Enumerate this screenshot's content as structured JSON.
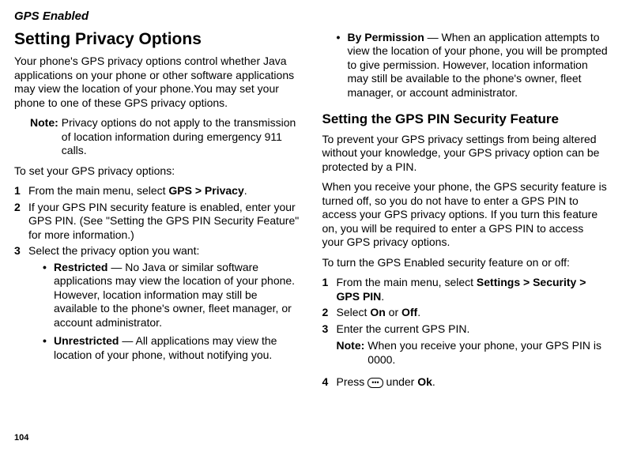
{
  "header": {
    "section_title": "GPS Enabled"
  },
  "left": {
    "h1": "Setting Privacy Options",
    "intro": "Your phone's GPS privacy options control whether Java applications on your phone or other software applications may view the location of your phone.You may set your phone to one of these GPS privacy options.",
    "note_label": "Note:",
    "note_text": "Privacy options do not apply to the transmission of location information during emergency 911 calls.",
    "to_set": "To set your GPS privacy options:",
    "step1_pre": "From the main menu, select ",
    "step1_bold": "GPS > Privacy",
    "step1_post": ".",
    "step2": "If your GPS PIN security feature is enabled, enter your GPS PIN. (See \"Setting the GPS PIN Security Feature\" for more information.)",
    "step3": "Select the privacy option you want:",
    "opt1_title": "Restricted",
    "opt1_body": " — No Java or similar software applications may view the location of your phone. However, location information may still be available to the phone's owner, fleet manager, or account administrator.",
    "opt2_title": "Unrestricted",
    "opt2_body": " — All applications may view the location of your phone, without notifying you."
  },
  "right": {
    "opt3_title": "By Permission",
    "opt3_body": " — When an application attempts to view the location of your phone, you will be prompted to give permission. However, location information may still be available to the phone's owner, fleet manager, or account administrator.",
    "h2": "Setting the GPS PIN Security Feature",
    "p1": "To prevent your GPS privacy settings from being altered without your knowledge, your GPS privacy option can be protected by a PIN.",
    "p2": "When you receive your phone, the GPS security feature is turned off, so you do not have to enter a GPS PIN to access your GPS privacy options. If you turn this feature on, you will be required to enter a GPS PIN to access your GPS privacy options.",
    "p3": "To turn the GPS Enabled security feature on or off:",
    "r_step1_pre": "From the main menu, select ",
    "r_step1_bold": "Settings > Security > GPS PIN",
    "r_step1_post": ".",
    "r_step2_pre": "Select ",
    "r_step2_on": "On",
    "r_step2_or": " or ",
    "r_step2_off": "Off",
    "r_step2_post": ".",
    "r_step3": "Enter the current GPS PIN.",
    "r_note_label": "Note:",
    "r_note_text": "When you receive your phone, your GPS PIN is 0000.",
    "r_step4_pre": "Press ",
    "r_step4_mid": " under ",
    "r_step4_ok": "Ok",
    "r_step4_post": "."
  },
  "footer": {
    "page_num": "104"
  }
}
